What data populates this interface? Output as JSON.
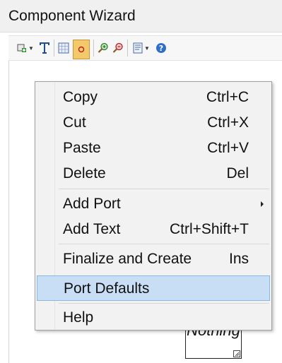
{
  "window": {
    "title": "Component Wizard"
  },
  "toolbar": {
    "items": [
      {
        "icon": "add-component-icon",
        "has_dropdown": true
      },
      {
        "icon": "text-tool-icon"
      },
      {
        "icon": "grid-icon"
      },
      {
        "icon": "port-tool-icon",
        "active": true
      },
      {
        "icon": "zoom-in-icon"
      },
      {
        "icon": "zoom-out-icon"
      },
      {
        "icon": "page-icon",
        "has_dropdown": true
      },
      {
        "icon": "help-icon"
      }
    ]
  },
  "canvas": {
    "component_label": "Nothing"
  },
  "context_menu": {
    "items": [
      {
        "label": "Copy",
        "shortcut": "Ctrl+C"
      },
      {
        "label": "Cut",
        "shortcut": "Ctrl+X"
      },
      {
        "label": "Paste",
        "shortcut": "Ctrl+V"
      },
      {
        "label": "Delete",
        "shortcut": "Del"
      },
      {
        "label": "Add Port",
        "shortcut": "",
        "submenu": true
      },
      {
        "label": "Add Text",
        "shortcut": "Ctrl+Shift+T"
      },
      {
        "label": "Finalize and Create",
        "shortcut": "Ins"
      },
      {
        "label": "Port Defaults",
        "shortcut": "",
        "highlighted": true
      },
      {
        "label": "Help",
        "shortcut": ""
      }
    ]
  },
  "colors": {
    "highlight": "#c8def4",
    "highlight_border": "#8ab6e2",
    "active_tool": "#f4c96a"
  }
}
